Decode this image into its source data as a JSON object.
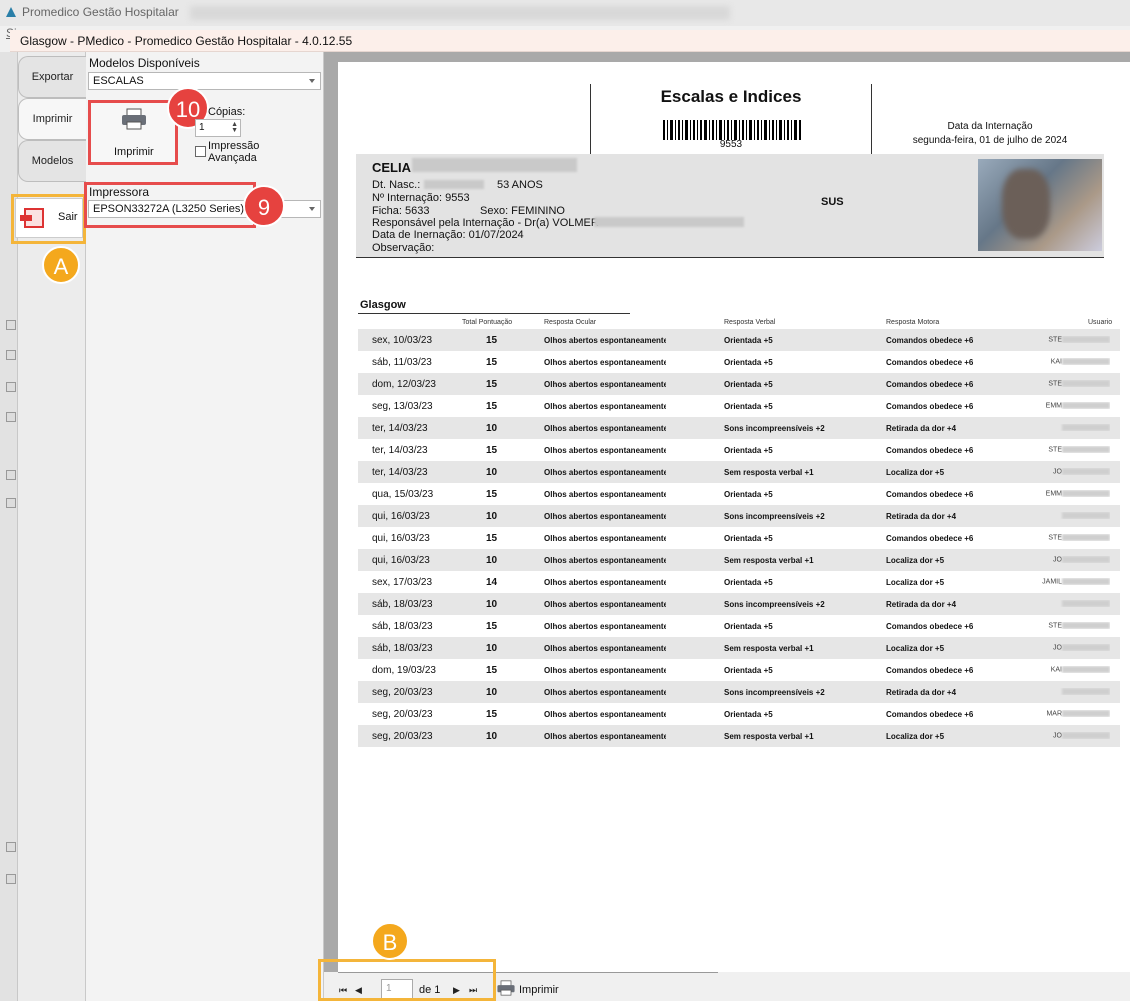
{
  "outer_window": {
    "title": "Promedico Gestão Hospitalar",
    "menu_hint": "Si"
  },
  "dialog": {
    "title": "Glasgow - PMedico - Promedico Gestão Hospitalar - 4.0.12.55"
  },
  "side_tabs": {
    "export": "Exportar",
    "print": "Imprimir",
    "models": "Modelos",
    "exit": "Sair"
  },
  "options": {
    "models_label": "Modelos Disponíveis",
    "models_value": "ESCALAS",
    "print_button": "Imprimir",
    "copies_label": "Cópias:",
    "copies_value": "1",
    "advanced_print": "Impressão Avançada",
    "printer_label": "Impressora",
    "printer_value": "EPSON33272A (L3250 Series)"
  },
  "callouts": {
    "a": "A",
    "b": "B",
    "nine": "9",
    "ten": "10"
  },
  "report": {
    "title": "Escalas e Indices",
    "barcode_number": "9553",
    "admission_label": "Data da Internação",
    "admission_date": "segunda-feira, 01 de julho de 2024",
    "patient": {
      "name": "CELIA",
      "birth_label": "Dt. Nasc.:",
      "age": "53 ANOS",
      "internment_line": "Nº Internação:  9553",
      "ficha_line": "Ficha:   5633",
      "sex_line": "Sexo:   FEMININO",
      "responsible_line": "Responsável pela Internação - Dr(a)  VOLMER",
      "internment_date_line": "Data de Inernação:  01/07/2024",
      "observation_label": "Observação:",
      "insurance": "SUS"
    },
    "table_title": "Glasgow",
    "columns": {
      "total": "Total Pontuação",
      "ocular": "Resposta Ocular",
      "verbal": "Resposta Verbal",
      "motor": "Resposta Motora",
      "user": "Usuario"
    },
    "rows": [
      {
        "date": "sex, 10/03/23",
        "total": "15",
        "ocular": "Olhos abertos espontaneamente",
        "verbal": "Orientada +5",
        "motor": "Comandos obedece +6",
        "user": "STE"
      },
      {
        "date": "sáb, 11/03/23",
        "total": "15",
        "ocular": "Olhos abertos espontaneamente",
        "verbal": "Orientada +5",
        "motor": "Comandos obedece +6",
        "user": "KAI"
      },
      {
        "date": "dom, 12/03/23",
        "total": "15",
        "ocular": "Olhos abertos espontaneamente",
        "verbal": "Orientada +5",
        "motor": "Comandos obedece +6",
        "user": "STE"
      },
      {
        "date": "seg, 13/03/23",
        "total": "15",
        "ocular": "Olhos abertos espontaneamente",
        "verbal": "Orientada +5",
        "motor": "Comandos obedece +6",
        "user": "EMM"
      },
      {
        "date": "ter, 14/03/23",
        "total": "10",
        "ocular": "Olhos abertos espontaneamente",
        "verbal": "Sons incompreensíveis +2",
        "motor": "Retirada da dor +4",
        "user": ""
      },
      {
        "date": "ter, 14/03/23",
        "total": "15",
        "ocular": "Olhos abertos espontaneamente",
        "verbal": "Orientada +5",
        "motor": "Comandos obedece +6",
        "user": "STE"
      },
      {
        "date": "ter, 14/03/23",
        "total": "10",
        "ocular": "Olhos abertos espontaneamente",
        "verbal": "Sem resposta verbal +1",
        "motor": "Localiza dor +5",
        "user": "JO"
      },
      {
        "date": "qua, 15/03/23",
        "total": "15",
        "ocular": "Olhos abertos espontaneamente",
        "verbal": "Orientada +5",
        "motor": "Comandos obedece +6",
        "user": "EMM"
      },
      {
        "date": "qui, 16/03/23",
        "total": "10",
        "ocular": "Olhos abertos espontaneamente",
        "verbal": "Sons incompreensíveis +2",
        "motor": "Retirada da dor +4",
        "user": ""
      },
      {
        "date": "qui, 16/03/23",
        "total": "15",
        "ocular": "Olhos abertos espontaneamente",
        "verbal": "Orientada +5",
        "motor": "Comandos obedece +6",
        "user": "STE"
      },
      {
        "date": "qui, 16/03/23",
        "total": "10",
        "ocular": "Olhos abertos espontaneamente",
        "verbal": "Sem resposta verbal +1",
        "motor": "Localiza dor +5",
        "user": "JO"
      },
      {
        "date": "sex, 17/03/23",
        "total": "14",
        "ocular": "Olhos abertos espontaneamente",
        "verbal": "Orientada +5",
        "motor": "Localiza dor +5",
        "user": "JAMIL"
      },
      {
        "date": "sáb, 18/03/23",
        "total": "10",
        "ocular": "Olhos abertos espontaneamente",
        "verbal": "Sons incompreensíveis +2",
        "motor": "Retirada da dor +4",
        "user": ""
      },
      {
        "date": "sáb, 18/03/23",
        "total": "15",
        "ocular": "Olhos abertos espontaneamente",
        "verbal": "Orientada +5",
        "motor": "Comandos obedece +6",
        "user": "STE"
      },
      {
        "date": "sáb, 18/03/23",
        "total": "10",
        "ocular": "Olhos abertos espontaneamente",
        "verbal": "Sem resposta verbal +1",
        "motor": "Localiza dor +5",
        "user": "JO"
      },
      {
        "date": "dom, 19/03/23",
        "total": "15",
        "ocular": "Olhos abertos espontaneamente",
        "verbal": "Orientada +5",
        "motor": "Comandos obedece +6",
        "user": "KAI"
      },
      {
        "date": "seg, 20/03/23",
        "total": "10",
        "ocular": "Olhos abertos espontaneamente",
        "verbal": "Sons incompreensíveis +2",
        "motor": "Retirada da dor +4",
        "user": ""
      },
      {
        "date": "seg, 20/03/23",
        "total": "15",
        "ocular": "Olhos abertos espontaneamente",
        "verbal": "Orientada +5",
        "motor": "Comandos obedece +6",
        "user": "MAR"
      },
      {
        "date": "seg, 20/03/23",
        "total": "10",
        "ocular": "Olhos abertos espontaneamente",
        "verbal": "Sem resposta verbal +1",
        "motor": "Localiza dor +5",
        "user": "JO"
      }
    ]
  },
  "navigator": {
    "page_value": "1",
    "of_label": "de 1",
    "print_label": "Imprimir"
  }
}
